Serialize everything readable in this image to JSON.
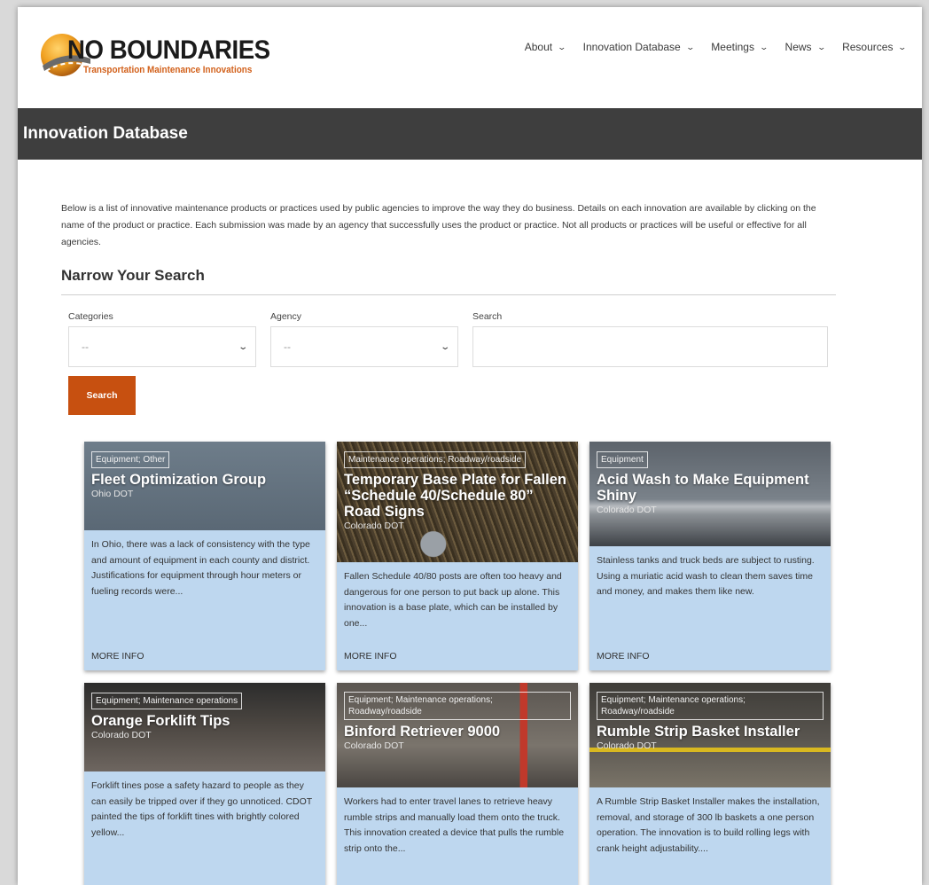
{
  "site": {
    "logo_title": "NO BOUNDARIES",
    "logo_subtitle": "Transportation Maintenance Innovations"
  },
  "nav": [
    {
      "label": "About"
    },
    {
      "label": "Innovation Database"
    },
    {
      "label": "Meetings"
    },
    {
      "label": "News"
    },
    {
      "label": "Resources"
    }
  ],
  "page_title": "Innovation Database",
  "intro": "Below is a list of innovative maintenance products or practices used by public agencies to improve the way they do business. Details on each innovation are available by clicking on the name of the product or practice. Each submission was made by an agency that successfully uses the product or practice. Not all products or practices will be useful or effective for all agencies.",
  "narrow_heading": "Narrow Your Search",
  "filters": {
    "categories_label": "Categories",
    "categories_value": "--",
    "agency_label": "Agency",
    "agency_value": "--",
    "search_label": "Search",
    "search_value": ""
  },
  "search_button": "Search",
  "more_info": "MORE INFO",
  "cards": [
    {
      "tag": "Equipment; Other",
      "title": "Fleet Optimization Group",
      "agency": "Ohio DOT",
      "desc": "In Ohio, there was a lack of consistency with the type and amount of equipment in each county and district. Justifications for equipment through hour meters or fueling records were..."
    },
    {
      "tag": "Maintenance operations; Roadway/roadside",
      "title": "Temporary Base Plate for Fallen “Schedule 40/Schedule 80” Road Signs",
      "agency": "Colorado DOT",
      "desc": "Fallen Schedule 40/80 posts are often too heavy and dangerous for one person to put back up alone. This innovation is a base plate, which can be installed by one..."
    },
    {
      "tag": "Equipment",
      "title": "Acid Wash to Make Equipment Shiny",
      "agency": "Colorado DOT",
      "desc": "Stainless tanks and truck beds are subject to rusting. Using a muriatic acid wash to clean them saves time and money, and makes them like new."
    },
    {
      "tag": "Equipment; Maintenance operations",
      "title": "Orange Forklift Tips",
      "agency": "Colorado DOT",
      "desc": "Forklift tines pose a safety hazard to people as they can easily be tripped over if they go unnoticed. CDOT painted the tips of forklift tines with brightly colored yellow..."
    },
    {
      "tag": "Equipment; Maintenance operations; Roadway/roadside",
      "title": "Binford Retriever 9000",
      "agency": "Colorado DOT",
      "desc": "Workers had to enter travel lanes to retrieve heavy rumble strips and manually load them onto the truck. This innovation created a device that pulls the rumble strip onto the..."
    },
    {
      "tag": "Equipment; Maintenance operations; Roadway/roadside",
      "title": "Rumble Strip Basket Installer",
      "agency": "Colorado DOT",
      "desc": "A Rumble Strip Basket Installer makes the installation, removal, and storage of 300 lb baskets a one person operation. The innovation is to build rolling legs with crank height adjustability...."
    }
  ],
  "colors": {
    "accent": "#c75010",
    "titlebar": "#3e3e3e",
    "card_body": "#bed7ef"
  }
}
